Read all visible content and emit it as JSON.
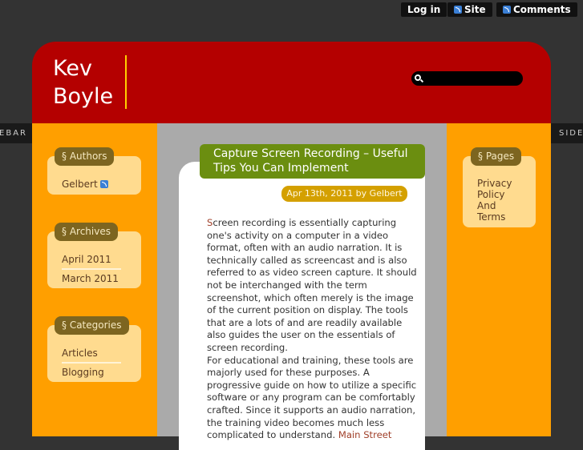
{
  "topbar": {
    "login": "Log in",
    "site": "Site",
    "comments": "Comments"
  },
  "sidetabs": {
    "left": "SIDEBAR",
    "right": "SIDEBAR"
  },
  "site": {
    "title_line1": "Kev",
    "title_line2": "Boyle",
    "search_placeholder": ""
  },
  "left_sidebar": {
    "authors": {
      "title": "§ Authors",
      "items": [
        {
          "label": "Gelbert"
        }
      ]
    },
    "archives": {
      "title": "§ Archives",
      "items": [
        {
          "label": "April 2011"
        },
        {
          "label": "March 2011"
        }
      ]
    },
    "categories": {
      "title": "§ Categories",
      "items": [
        {
          "label": "Articles"
        },
        {
          "label": "Blogging"
        }
      ]
    }
  },
  "right_sidebar": {
    "pages": {
      "title": "§ Pages",
      "items": [
        {
          "label": "Privacy Policy And Terms"
        }
      ]
    }
  },
  "post": {
    "title": "Capture Screen Recording – Useful Tips You Can Implement",
    "meta": "Apr 13th, 2011 by Gelbert",
    "dropcap": "S",
    "lines": [
      "creen recording is essentially capturing",
      "one's activity on a computer in a video",
      "format, often with an audio narration. It is",
      "technically called as screencast and is also",
      "referred to as video screen capture. It should",
      "not be interchanged with the term",
      "screenshot, which often merely is the image",
      "of the current position on display. The tools",
      "that are a lots of and are readily available",
      "also guides the user on the essentials of",
      "screen recording.",
      "For educational and training, these tools are",
      "majorly used for these purposes. A",
      "progressive guide on how to utilize a specific",
      "software or any program can be comfortably",
      "crafted. Since it supports an audio narration,",
      "the training video becomes much less"
    ],
    "last_line": "complicated to understand.",
    "link": "Main Street"
  }
}
